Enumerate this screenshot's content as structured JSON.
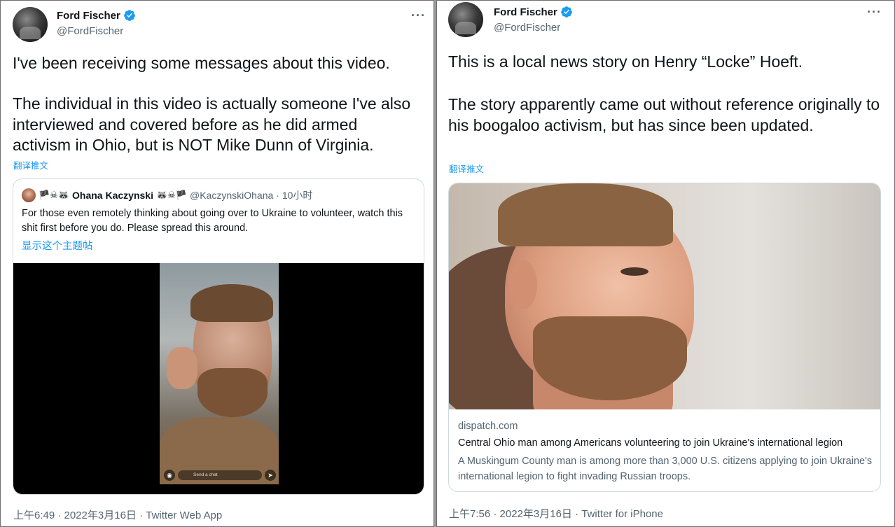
{
  "colors": {
    "accent": "#1d9bf0",
    "text": "#0f1419",
    "secondary": "#536471",
    "border": "#cfd9de"
  },
  "left_tweet": {
    "author_name": "Ford Fischer",
    "author_handle": "@FordFischer",
    "more_label": "···",
    "text_line1": "I've been receiving some messages about this video.",
    "text_paragraph2": "The individual in this video is actually someone I've also interviewed and covered before as he did armed activism in Ohio, but is NOT Mike Dunn of Virginia.",
    "translate_label": "翻译推文",
    "quoted": {
      "name_prefix_emoji": "🏴☠🦝",
      "name": "Ohana Kaczynski",
      "name_suffix_emoji": "🦝☠🏴",
      "handle": "@KaczynskiOhana",
      "time": "· 10小时",
      "text": "For those even remotely thinking about going over to Ukraine to volunteer, watch this shit first before you do. Please spread this around.",
      "show_thread_label": "显示这个主题帖",
      "video_caption_placeholder": "Send a chat"
    },
    "footer": "上午6:49 · 2022年3月16日 · Twitter Web App"
  },
  "right_tweet": {
    "author_name": "Ford Fischer",
    "author_handle": "@FordFischer",
    "more_label": "···",
    "text_line1": "This is a local news story on Henry “Locke” Hoeft.",
    "text_paragraph2": "The story apparently came out without reference originally to his boogaloo activism, but has since been updated.",
    "translate_label": "翻译推文",
    "link_card": {
      "domain": "dispatch.com",
      "title": "Central Ohio man among Americans volunteering to join Ukraine's international legion",
      "description": "A Muskingum County man is among more than 3,000 U.S. citizens applying to join Ukraine's international legion to fight invading Russian troops."
    },
    "footer": "上午7:56 · 2022年3月16日 · Twitter for iPhone"
  }
}
